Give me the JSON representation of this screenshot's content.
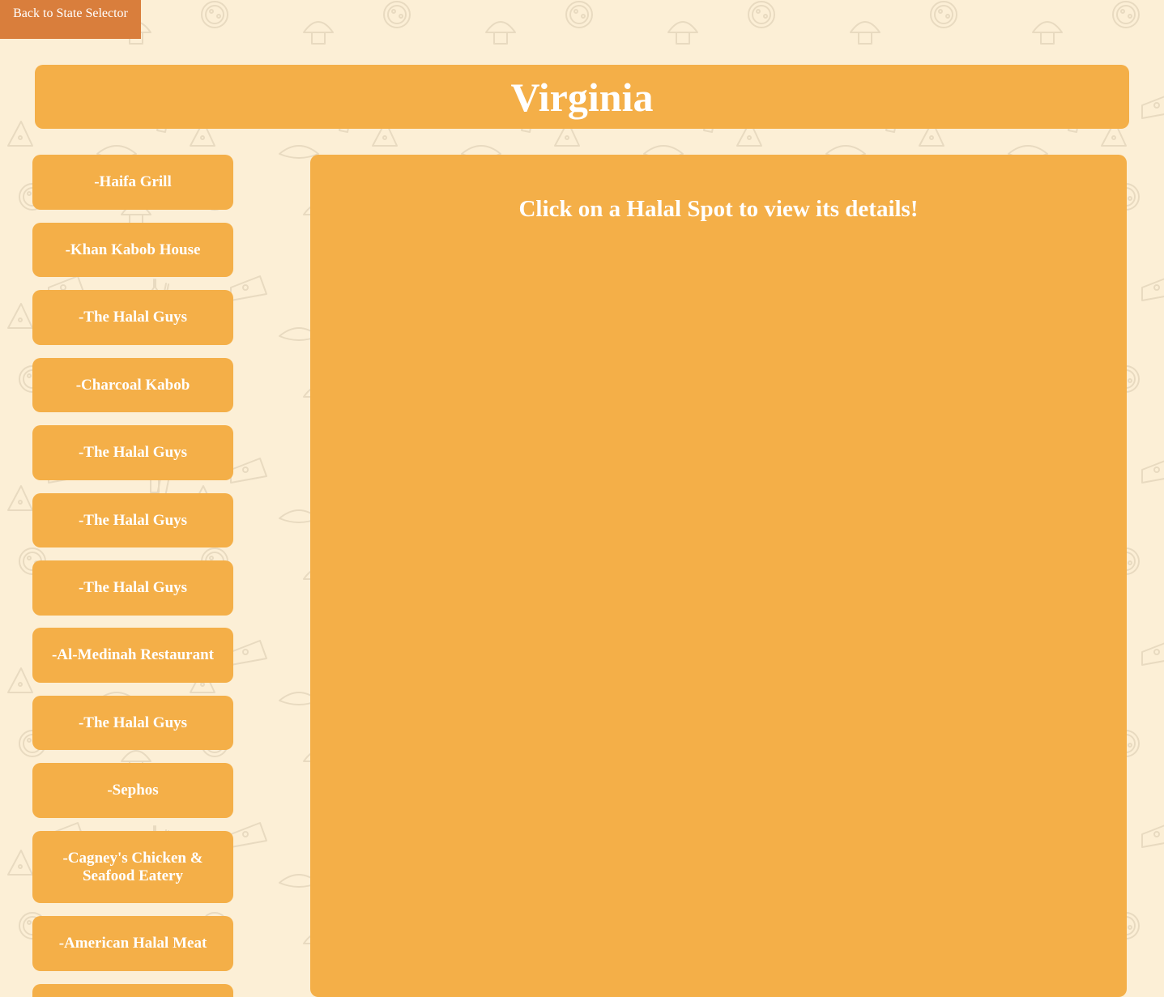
{
  "nav": {
    "back_label": "Back to State Selector"
  },
  "header": {
    "state_name": "Virginia"
  },
  "spots": [
    {
      "label": "-Haifa Grill"
    },
    {
      "label": "-Khan Kabob House"
    },
    {
      "label": "-The Halal Guys"
    },
    {
      "label": "-Charcoal Kabob"
    },
    {
      "label": "-The Halal Guys"
    },
    {
      "label": "-The Halal Guys"
    },
    {
      "label": "-The Halal Guys"
    },
    {
      "label": "-Al-Medinah Restaurant"
    },
    {
      "label": "-The Halal Guys"
    },
    {
      "label": "-Sephos"
    },
    {
      "label": "-Cagney's Chicken & Seafood Eatery"
    },
    {
      "label": "-American Halal Meat"
    },
    {
      "label": ""
    }
  ],
  "details": {
    "prompt": "Click on a Halal Spot to view its details!"
  },
  "colors": {
    "background": "#fcefd6",
    "card": "#f4af48",
    "back_button": "#d97e3c",
    "text": "#ffffff",
    "pattern": "#e9dcc3"
  }
}
